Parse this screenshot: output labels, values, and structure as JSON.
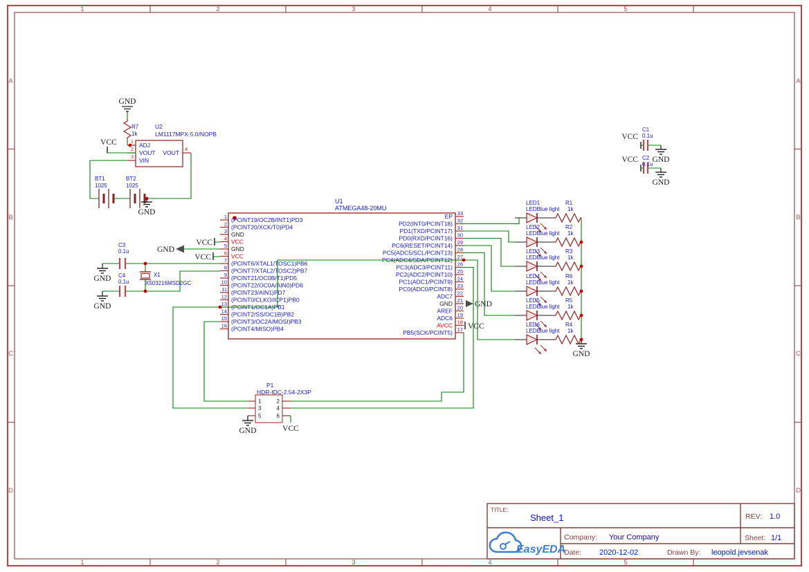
{
  "frame": {
    "cols": [
      "1",
      "2",
      "3",
      "4",
      "5"
    ],
    "rows": [
      "A",
      "B",
      "C",
      "D"
    ]
  },
  "nets": {
    "vcc": "VCC",
    "gnd": "GND"
  },
  "u1": {
    "ref": "U1",
    "part": "ATMEGA48-20MU",
    "left_pins": [
      {
        "num": "1",
        "label": "(PCINT19/OC2B/INT1)PD3"
      },
      {
        "num": "2",
        "label": "(PCINT20/XCK/T0)PD4"
      },
      {
        "num": "3",
        "label": "GND"
      },
      {
        "num": "4",
        "label": "VCC"
      },
      {
        "num": "5",
        "label": "GND"
      },
      {
        "num": "6",
        "label": "VCC"
      },
      {
        "num": "7",
        "label": "(PCINT6/XTAL1/TOSC1)PB6"
      },
      {
        "num": "8",
        "label": "(PCINT7/XTAL2/TOSC2)PB7"
      },
      {
        "num": "9",
        "label": "(PCINT21/OC0B/T1)PD5"
      },
      {
        "num": "10",
        "label": "(PCINT22/OC0A/AIN0)PD6"
      },
      {
        "num": "11",
        "label": "(PCINT23/AIN1)PD7"
      },
      {
        "num": "12",
        "label": "(PCINT0/CLKO/ICP1)PB0"
      },
      {
        "num": "13",
        "label": "(PCINT1/OC1A)PB1"
      },
      {
        "num": "14",
        "label": "(PCINT2/SS/OC1B)PB2"
      },
      {
        "num": "15",
        "label": "(PCINT3/OC2A/MOSI)PB3"
      },
      {
        "num": "16",
        "label": "(PCINT4/MISO)PB4"
      }
    ],
    "right_pins": [
      {
        "num": "33",
        "label": "EP"
      },
      {
        "num": "32",
        "label": "PD2(INT0/PCINT18)"
      },
      {
        "num": "31",
        "label": "PD1(TXD/PCINT17)"
      },
      {
        "num": "30",
        "label": "PD0(RXD/PCINT16)"
      },
      {
        "num": "29",
        "label": "PC6(RESET/PCINT14)"
      },
      {
        "num": "28",
        "label": "PC5(ADC5/SCL/PCINT13)"
      },
      {
        "num": "27",
        "label": "PC4(ADC4/SDA/PCINT12)"
      },
      {
        "num": "26",
        "label": "PC3(ADC3/PCINT11)"
      },
      {
        "num": "25",
        "label": "PC2(ADC2/PCINT10)"
      },
      {
        "num": "24",
        "label": "PC1(ADC1/PCINT9)"
      },
      {
        "num": "23",
        "label": "PC0(ADC0/PCINT8)"
      },
      {
        "num": "22",
        "label": "ADC7"
      },
      {
        "num": "21",
        "label": "GND"
      },
      {
        "num": "20",
        "label": "AREF"
      },
      {
        "num": "19",
        "label": "ADC6"
      },
      {
        "num": "18",
        "label": "AVCC"
      },
      {
        "num": "17",
        "label": "PB5(SCK/PCINT5)"
      }
    ]
  },
  "u2": {
    "ref": "U2",
    "part": "LM1117MPX-5.0/NOPB",
    "pin_nums": [
      "1",
      "2",
      "3",
      "4"
    ],
    "pin_names": [
      "ADJ",
      "VOUT",
      "VIN",
      "VOUT"
    ]
  },
  "r7": {
    "ref": "R7",
    "value": "1k"
  },
  "batteries": [
    {
      "ref": "BT1",
      "value": "1025"
    },
    {
      "ref": "BT2",
      "value": "1025"
    }
  ],
  "caps": [
    {
      "ref": "C1",
      "value": "0.1u"
    },
    {
      "ref": "C2",
      "value": "0.1u"
    },
    {
      "ref": "C3",
      "value": "0.1u"
    },
    {
      "ref": "C4",
      "value": "0.1u"
    }
  ],
  "crystal": {
    "ref": "X1",
    "part": "X503216MSD2GC"
  },
  "p1": {
    "ref": "P1",
    "part": "HDR-IDC-2.54-2X3P",
    "pin_nums": [
      "1",
      "2",
      "3",
      "4",
      "5",
      "6"
    ]
  },
  "leds": [
    {
      "ref": "LED1",
      "desc": "LEDBlue light",
      "res_ref": "R1",
      "res_value": "1k"
    },
    {
      "ref": "LED2",
      "desc": "LEDBlue light",
      "res_ref": "R2",
      "res_value": "1k"
    },
    {
      "ref": "LED3",
      "desc": "LEDBlue light",
      "res_ref": "R3",
      "res_value": "1k"
    },
    {
      "ref": "LED4",
      "desc": "LEDBlue light",
      "res_ref": "R6",
      "res_value": "1k"
    },
    {
      "ref": "LED5",
      "desc": "LEDBlue light",
      "res_ref": "R5",
      "res_value": "1k"
    },
    {
      "ref": "LED6",
      "desc": "LEDBlue light",
      "res_ref": "R4",
      "res_value": "1k"
    }
  ],
  "title_block": {
    "title_label": "TITLE:",
    "title": "Sheet_1",
    "rev_label": "REV:",
    "rev": "1.0",
    "company_label": "Company:",
    "company": "Your Company",
    "sheet_label": "Sheet:",
    "sheet": "1/1",
    "date_label": "Date:",
    "date": "2020-12-02",
    "drawn_label": "Drawn By:",
    "drawn_by": "leopold.jevsenak",
    "logo_text": "EasyEDA"
  },
  "colors": {
    "frame": "#9d5353",
    "wire": "#008000",
    "component": "#9f2b2b",
    "plate": "#b24d4d",
    "blue": "#1414dc",
    "red": "#e60000",
    "dark": "#1a1a1a",
    "dot": "#cc0000",
    "flag": "#4d4d4d",
    "logo": "#3c7ecf",
    "tb_label": "#8b3a3a",
    "tb_value": "#0b0bd0"
  }
}
